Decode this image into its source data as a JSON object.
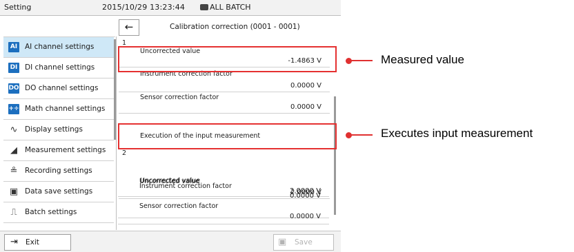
{
  "topbar": {
    "title": "Setting",
    "datetime": "2015/10/29 13:23:44",
    "batch_label": "ALL BATCH"
  },
  "subheader": {
    "title": "Calibration correction (0001 - 0001)"
  },
  "sidebar": {
    "items": [
      {
        "icon_text": "AI",
        "label": "AI channel settings",
        "active": true
      },
      {
        "icon_text": "DI",
        "label": "DI channel settings"
      },
      {
        "icon_text": "DO",
        "label": "DO channel settings"
      },
      {
        "icon_text": "+÷",
        "label": "Math channel settings"
      },
      {
        "icon_text": "∿",
        "label": "Display settings"
      },
      {
        "icon_text": "◢",
        "label": "Measurement settings"
      },
      {
        "icon_text": "≗",
        "label": "Recording settings"
      },
      {
        "icon_text": "▣",
        "label": "Data save settings"
      },
      {
        "icon_text": "⎍",
        "label": "Batch settings"
      }
    ]
  },
  "groups": [
    {
      "number": "1",
      "fields": [
        {
          "label": "Uncorrected value",
          "value": "-1.4863 V"
        },
        {
          "label": "Instrument correction factor",
          "value": "0.0000 V"
        },
        {
          "label": "Sensor correction factor",
          "value": "0.0000 V"
        }
      ],
      "exec_label": "Execution of the input measurement"
    },
    {
      "number": "2",
      "fields": [
        {
          "label": "Uncorrected value",
          "value": "2.0000 V"
        },
        {
          "label": "Instrument correction factor",
          "value": "0.0000 V"
        },
        {
          "label": "Sensor correction factor",
          "value": "0.0000 V"
        }
      ]
    }
  ],
  "bottombar": {
    "exit_label": "Exit",
    "save_label": "Save"
  },
  "callouts": {
    "measured": "Measured value",
    "executes": "Executes input measurement",
    "color": "#e03030"
  }
}
